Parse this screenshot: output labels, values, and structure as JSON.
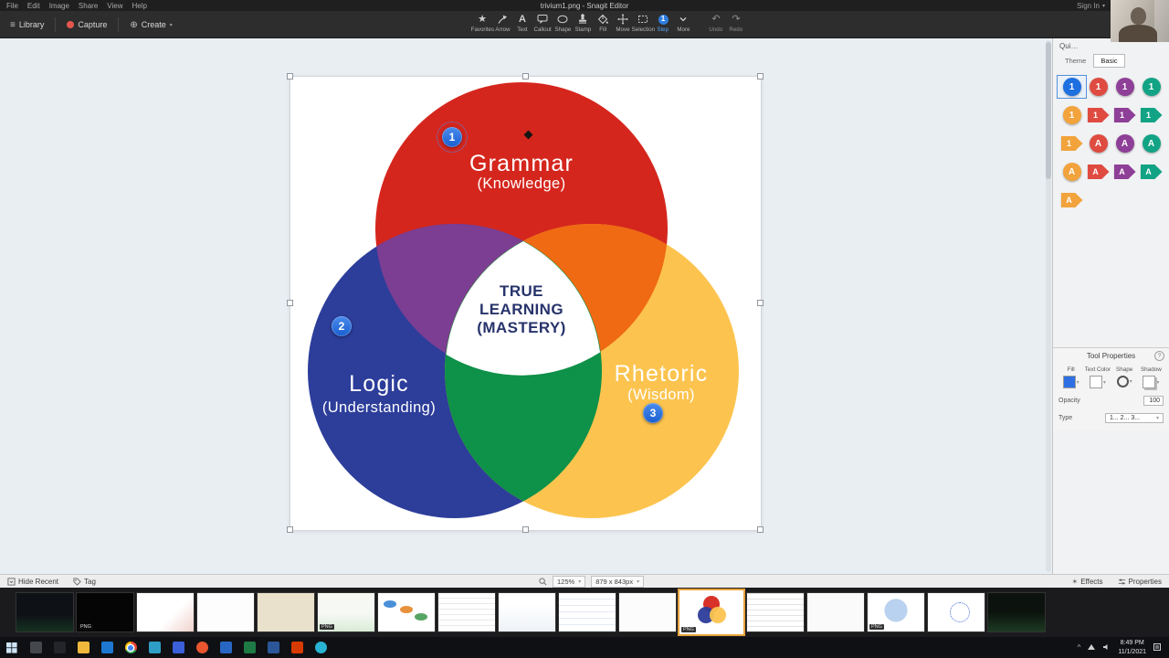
{
  "window": {
    "menus": [
      "File",
      "Edit",
      "Image",
      "Share",
      "View",
      "Help"
    ],
    "title": "trivium1.png - Snagit Editor",
    "sign_in": "Sign In"
  },
  "toolbar": {
    "library": "Library",
    "capture": "Capture",
    "create": "Create",
    "tools": [
      {
        "label": "Favorites"
      },
      {
        "label": "Arrow"
      },
      {
        "label": "Text"
      },
      {
        "label": "Callout"
      },
      {
        "label": "Shape"
      },
      {
        "label": "Stamp"
      },
      {
        "label": "Fill"
      },
      {
        "label": "Move"
      },
      {
        "label": "Selection"
      },
      {
        "label": "Step"
      },
      {
        "label": "More"
      }
    ],
    "undo": "Undo",
    "redo": "Redo"
  },
  "canvas": {
    "diagram": {
      "grammar_title": "Grammar",
      "grammar_sub": "(Knowledge)",
      "logic_title": "Logic",
      "logic_sub": "(Understanding)",
      "rhetoric_title": "Rhetoric",
      "rhetoric_sub": "(Wisdom)",
      "center_line1": "TRUE",
      "center_line2": "LEARNING",
      "center_line3": "(MASTERY)",
      "colors": {
        "grammar": "#d5261d",
        "logic": "#2c3d9a",
        "rhetoric": "#fcc44f",
        "grammar_logic": "#7b3e92",
        "grammar_rhetoric": "#ef6a13",
        "logic_rhetoric": "#0e9148",
        "center_text": "#27336b",
        "step_marker": "#1b66dd"
      },
      "steps": [
        {
          "n": "1"
        },
        {
          "n": "2"
        },
        {
          "n": "3"
        }
      ]
    }
  },
  "quick_styles": {
    "title": "Quick Styles",
    "tabs": [
      {
        "label": "Theme"
      },
      {
        "label": "Basic"
      }
    ],
    "items": [
      {
        "glyph": "1",
        "color": "#1e6fe0"
      },
      {
        "glyph": "1",
        "color": "#df4b41"
      },
      {
        "glyph": "1",
        "color": "#8e3f97"
      },
      {
        "glyph": "1",
        "color": "#12a385"
      },
      {
        "glyph": "1",
        "color": "#f2a33c"
      },
      {
        "glyph": "1",
        "color": "#df4b41"
      },
      {
        "glyph": "1",
        "color": "#8e3f97"
      },
      {
        "glyph": "1",
        "color": "#12a385"
      },
      {
        "glyph": "1",
        "color": "#f2a33c"
      },
      {
        "glyph": "A",
        "color": "#df4b41"
      },
      {
        "glyph": "A",
        "color": "#8e3f97"
      },
      {
        "glyph": "A",
        "color": "#12a385"
      },
      {
        "glyph": "A",
        "color": "#f2a33c"
      },
      {
        "glyph": "A",
        "color": "#df4b41"
      },
      {
        "glyph": "A",
        "color": "#8e3f97"
      },
      {
        "glyph": "A",
        "color": "#12a385"
      },
      {
        "glyph": "A",
        "color": "#f2a33c"
      }
    ]
  },
  "tool_properties": {
    "title": "Tool Properties",
    "help": "?",
    "fill_label": "Fill",
    "fill_color": "#2f6fe4",
    "text_color_label": "Text Color",
    "shape_label": "Shape",
    "shadow_label": "Shadow",
    "opacity_label": "Opacity",
    "opacity_value": "100",
    "type_label": "Type",
    "type_value": "1... 2... 3..."
  },
  "status_bar": {
    "hide_recent": "Hide Recent",
    "tag": "Tag",
    "zoom": "125%",
    "dimensions": "879 x 843px",
    "effects": "Effects",
    "properties": "Properties"
  },
  "recent": {
    "thumbs": [
      {
        "badge": ""
      },
      {
        "badge": "PNG"
      },
      {
        "badge": ""
      },
      {
        "badge": ""
      },
      {
        "badge": ""
      },
      {
        "badge": "PNG"
      },
      {
        "badge": ""
      },
      {
        "badge": ""
      },
      {
        "badge": ""
      },
      {
        "badge": ""
      },
      {
        "badge": ""
      },
      {
        "badge": "PNG"
      },
      {
        "badge": ""
      },
      {
        "badge": ""
      },
      {
        "badge": "PNG"
      },
      {
        "badge": ""
      },
      {
        "badge": ""
      }
    ]
  },
  "taskbar": {
    "time": "8:49 PM",
    "date": "11/1/2021"
  }
}
